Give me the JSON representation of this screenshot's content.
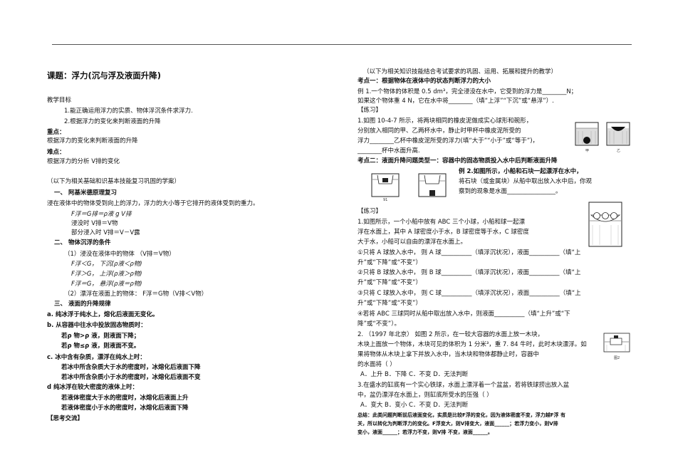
{
  "header": {
    "top_rule": true
  },
  "left": {
    "title": "课题：浮力(沉与浮及液面升降)",
    "objectives_head": "教学目标",
    "obj1": "1.能正确运用浮力的实质、物体浮沉条件求浮力.",
    "obj2": "2.根据浮力的变化来判断液面的升降",
    "key_head": "重点：",
    "key": "根据浮力的变化来判断液面的升降",
    "diff_head": "难点：",
    "diff": "根据浮力的分析  V排的变化",
    "review_note": "（以下为相关基础和识基本技能复习巩固的学案）",
    "sec1": "一、    阿基米德原理复习",
    "sec1_text": "浸在液体中的物体受到向上的浮力，浮力的大小等于它排开的液体受到的重力。",
    "f1": "F浮＝G排＝ρ液 g V排",
    "f2": "浸没时  V排＝V物",
    "f3": "部分浸入时  V排＝V－V露",
    "sec2": "二、    物体沉浮的条件",
    "c1": "（1）浸没在液体中的物体  （V排＝V物）",
    "c2": "F浮＜G，  下沉(ρ液＜ρ物)",
    "c3": "F浮＞G，  上浮(ρ液＞ρ物)",
    "c4": "F浮＝G，  悬浮(ρ液＝ρ物)",
    "c5": "（2）漂浮在液面上的物体：  F浮＝G物（V排＜V物）",
    "sec3": "三、    液面的升降规律",
    "r_a": "a. 纯冰浮于纯水上，熔化后液面无变化。",
    "r_b": "b. 从容器中往水中投放固态物质时：",
    "r_b1": "若ρ 物>ρ 液，则液面下降；",
    "r_b2": "若ρ 物≤ρ 液，则液面不变。",
    "r_c": "c. 冰中含有杂质，漂浮在纯水上时：",
    "r_c1": "若冰中所含杂质大于水的密度时，冰熔化后液面下降",
    "r_c2": "若冰中所含杂质小于水的密度时，冰熔化后液面不变",
    "r_d": "d 纯冰浮在较大密度的液体上时：",
    "r_d1": "若液体密度大于水的密度时，冰熔化后液面上升",
    "r_d2": "若液体密度小于水的密度时，冰熔化后液面下降",
    "think": "【思考交流】"
  },
  "right": {
    "note": "（以下为相关知识技能结合考试要求的巩固、运用、拓展和提升的教学）",
    "pt1": "考点一：根据物体在液体中的状态判断浮力的大小",
    "ex1_a": "例 1.一个物体的体积是 0.5 dm³，完全浸没在水中，它受到的浮力是________N；",
    "ex1_b": "如果这个物体重 4 N，它在水中将________（填“上浮”“下沉”或“悬浮”）.",
    "practice1": "【练习】",
    "p1_a": "1.如图 10-4-7 所示，将两块相同的橡皮泥做成实心球形和碗形，",
    "p1_b": "分别放入相同的甲、乙两杯水中，静止时甲杯中橡皮泥所受的",
    "p1_c": "浮力________乙杯中橡皮泥所受的浮力(填“大于”“小于”或“等于”)，",
    "p1_d": "________杯中水面升高.",
    "fig1_cap1": "甲",
    "fig1_cap2": "乙",
    "pt2": "考点二：液面升降问题类型一：容器中的固态物质投入水中后判断液面升降",
    "ex2_a": "例 2.如图所示，小船和石块一起漂浮在水中，",
    "ex2_b": "将石块（或金属块）从船中取出放入水中后，你观",
    "ex2_c": "察到的现象是水面________________。",
    "fig2_cap": "91",
    "practice2": "【练习】",
    "q1_a": "1.如图所示，一个小船中放有 ABC 三个小球，小船和球一起漂",
    "q1_b": "浮在水面上，其中 A 球密度小于水，B 球密度等于水，C 球密度",
    "q1_c": "大于水，小船可以自由的漂浮在水面上。",
    "q1_1a": "①只将 A 球放入水中，  则 A 球__________（填浮沉状况），液面__________（填“上",
    "q1_1b": "升”或“下降”或“不变”）",
    "q1_2a": "②只将 B 球放入水中，  则 B 球__________（填浮沉状况），液面__________（填“上",
    "q1_2b": "升”或“下降”或“不变”）",
    "q1_3a": "③只将 C 球放入水中，  则 C 球__________（填浮沉状况），液面__________（填“上",
    "q1_3b": "升”或“下降”或“不变”）",
    "q1_4a": "④若将 ABC 三球同时从船中取出放入水中，则液面__________（填“上升”或“下",
    "q1_4b": "降”或“不变”）。",
    "q2_a": "2. （1997 年北京）    如图 2 所示，在一较大容器的水面上放一木块，",
    "q2_b": "木块上面放一个物体，木块可见的体积为 1 分米³，重 7. 84 牛时，此时木块漂浮。如",
    "q2_c": "果将物体从木块上拿下并放入水中，当木块和物体都静止时，容器中",
    "q2_d": "的水面将（    ）",
    "q2_opts": "A．上升    B．下降    C．不变    D．无法判断",
    "fig4_cap": "图2",
    "q3_a": "3.在盛水的缸底有一个实心铁球，水面上漂浮着一个盆盆，若将铁球捞出放入盆",
    "q3_b": "中，盆仍漂浮在水面上，则缸底所受水的压强（        ）",
    "q3_opts": "A．变大    B．变小    C．不变    D．无法判断",
    "sum_a": "总结：此类问题判断前后液面变化，实质是比较F浮的变化，因为液体密度不变，浮力越F浮 有",
    "sum_b": "关，所以转化为判断浮力的变化。F浮变大，则V排变大，液面______；若浮力变小，则V排",
    "sum_c": "变小，液面______；若浮力不变，则V排 不变，液面______。"
  }
}
